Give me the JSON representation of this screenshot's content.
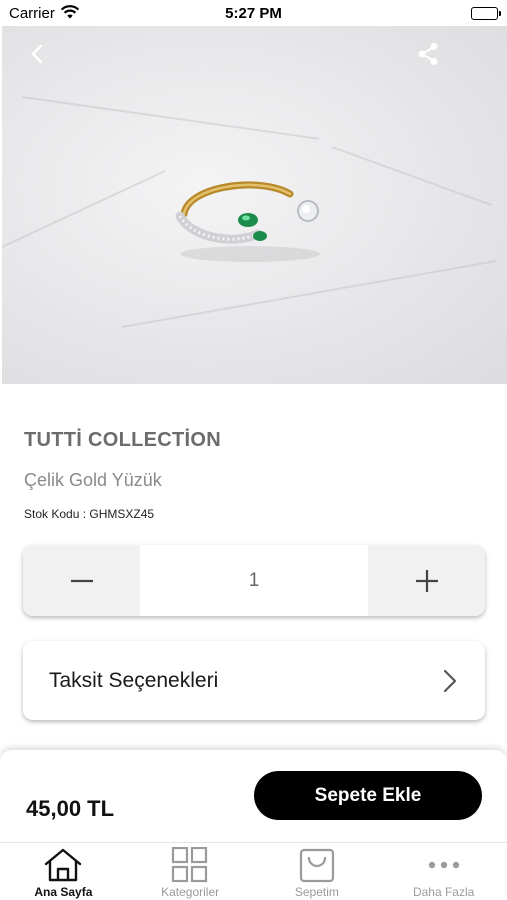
{
  "status_bar": {
    "carrier": "Carrier",
    "time": "5:27 PM"
  },
  "product": {
    "brand": "TUTTİ COLLECTİON",
    "name": "Çelik Gold Yüzük",
    "sku": "Stok Kodu : GHMSXZ45"
  },
  "quantity": {
    "minus": "−",
    "value": "1",
    "plus": "+"
  },
  "installment": {
    "label": "Taksit Seçenekleri"
  },
  "cart": {
    "price": "45,00 TL",
    "add_button": "Sepete Ekle"
  },
  "tabs": [
    {
      "label": "Ana Sayfa",
      "icon": "home-icon",
      "active": true
    },
    {
      "label": "Kategoriler",
      "icon": "grid-icon",
      "active": false
    },
    {
      "label": "Sepetim",
      "icon": "bag-icon",
      "active": false
    },
    {
      "label": "Daha Fazla",
      "icon": "more-icon",
      "active": false
    }
  ],
  "colors": {
    "accent": "#000000",
    "muted_text": "#8a8a8a",
    "brand_text": "#6c6c6c",
    "stepper_bg": "#f1f1f2"
  }
}
